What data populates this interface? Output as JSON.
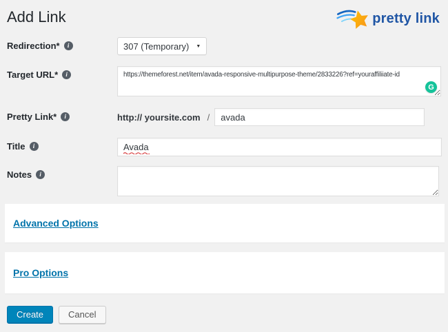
{
  "page": {
    "title": "Add Link"
  },
  "logo": {
    "text": "pretty link"
  },
  "form": {
    "redirection": {
      "label": "Redirection*",
      "value": "307 (Temporary)"
    },
    "target_url": {
      "label": "Target URL*",
      "value": "https://themeforest.net/item/avada-responsive-multipurpose-theme/2833226?ref=youraffiliiate-id"
    },
    "pretty_link": {
      "label": "Pretty Link*",
      "prefix": "http:// yoursite.com",
      "separator": "/",
      "value": "avada"
    },
    "title": {
      "label": "Title",
      "value": "Avada"
    },
    "notes": {
      "label": "Notes",
      "value": ""
    }
  },
  "sections": {
    "advanced_label": "Advanced Options",
    "pro_label": "Pro Options"
  },
  "actions": {
    "create_label": "Create",
    "cancel_label": "Cancel"
  },
  "icons": {
    "info": "i",
    "select_caret": "▼",
    "grammarly": "G"
  },
  "colors": {
    "page_background": "#f1f1f1",
    "primary_button_blue": "#0085ba",
    "link_blue": "#0073aa",
    "logo_blue": "#2056a5",
    "grammarly_green": "#15c39a",
    "focus_border_blue": "#5b9dd9",
    "star_gold": "#ffc200"
  }
}
